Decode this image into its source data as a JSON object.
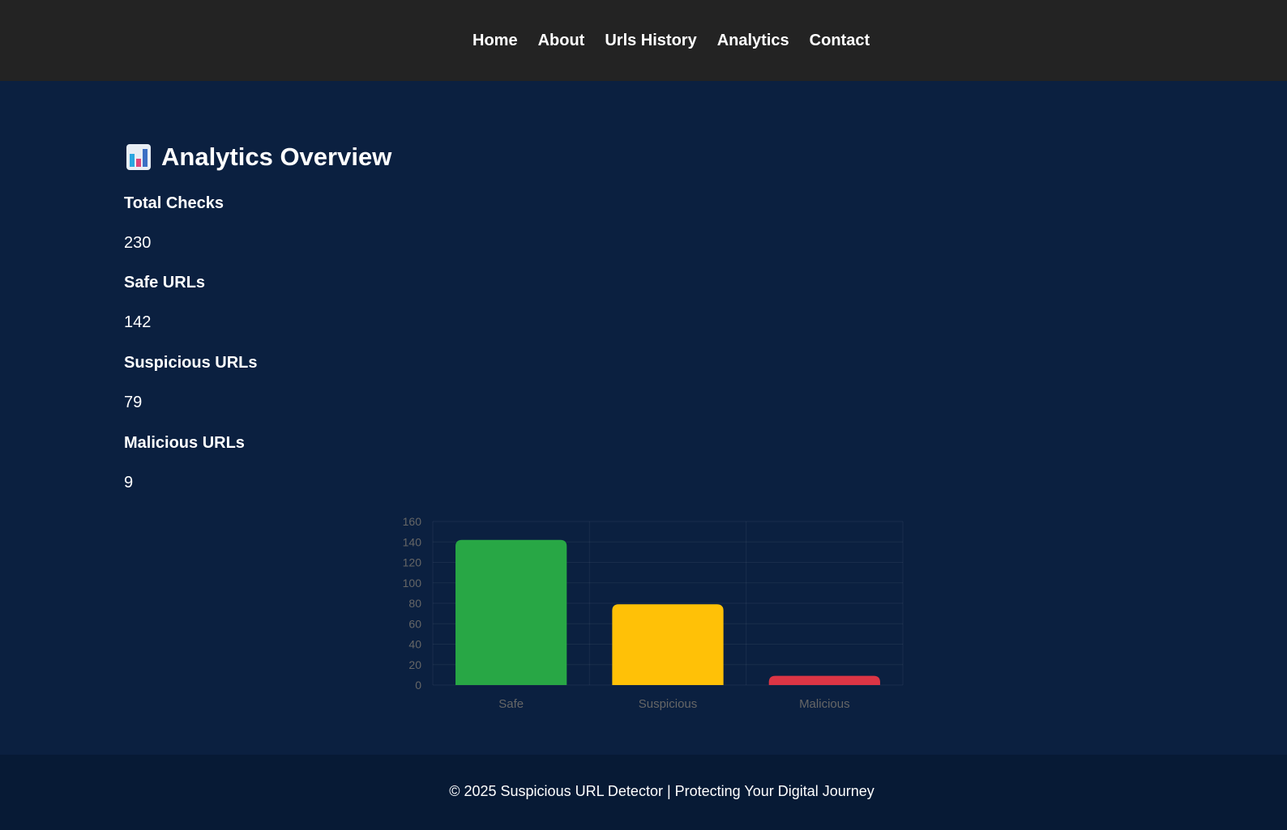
{
  "nav": {
    "items": [
      {
        "label": "Home"
      },
      {
        "label": "About"
      },
      {
        "label": "Urls History"
      },
      {
        "label": "Analytics"
      },
      {
        "label": "Contact"
      }
    ]
  },
  "page": {
    "title_icon": "bar-chart-icon",
    "title": "Analytics Overview"
  },
  "stats": [
    {
      "label": "Total Checks",
      "value": "230"
    },
    {
      "label": "Safe URLs",
      "value": "142"
    },
    {
      "label": "Suspicious URLs",
      "value": "79"
    },
    {
      "label": "Malicious URLs",
      "value": "9"
    }
  ],
  "chart_data": {
    "type": "bar",
    "categories": [
      "Safe",
      "Suspicious",
      "Malicious"
    ],
    "values": [
      142,
      79,
      9
    ],
    "colors": [
      "#28a745",
      "#ffc107",
      "#dc3545"
    ],
    "ylim": [
      0,
      160
    ],
    "yticks": [
      "0",
      "20",
      "40",
      "60",
      "80",
      "100",
      "120",
      "140",
      "160"
    ],
    "grid": true,
    "legend": false
  },
  "footer": {
    "text": "© 2025 Suspicious URL Detector | Protecting Your Digital Journey"
  },
  "colors": {
    "header_bg": "#232323",
    "main_bg": "#0b2040",
    "footer_bg": "#071a35",
    "text": "#ffffff",
    "axis_text": "#666666"
  }
}
